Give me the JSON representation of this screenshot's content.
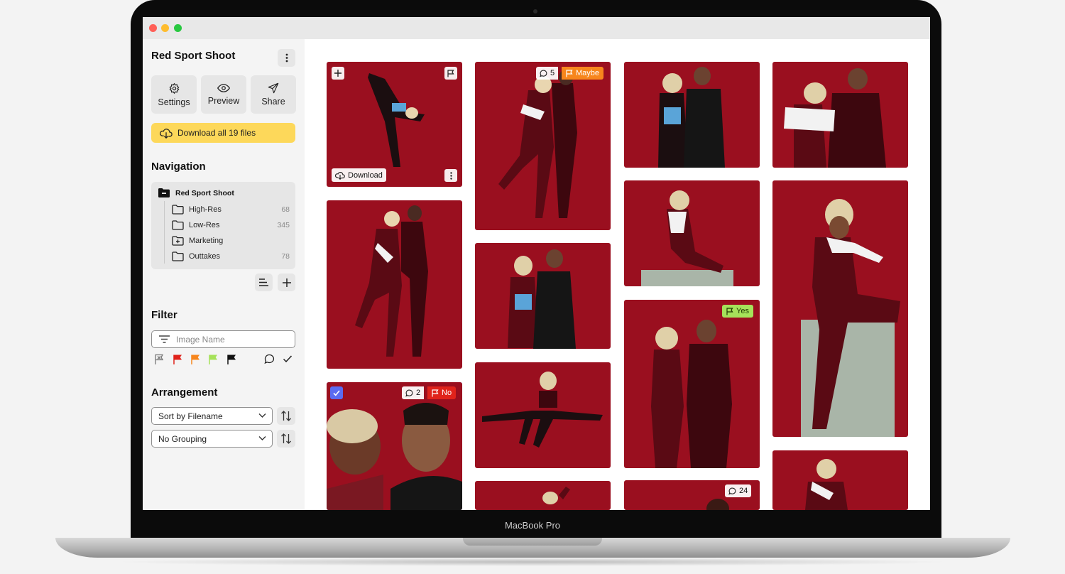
{
  "device": {
    "label": "MacBook Pro"
  },
  "sidebar": {
    "project_title": "Red Sport Shoot",
    "actions": {
      "settings": "Settings",
      "preview": "Preview",
      "share": "Share"
    },
    "download_all": "Download all 19 files",
    "navigation": {
      "title": "Navigation",
      "root": "Red Sport Shoot",
      "folders": [
        {
          "name": "High-Res",
          "count": "68",
          "icon": "folder-icon"
        },
        {
          "name": "Low-Res",
          "count": "345",
          "icon": "folder-icon"
        },
        {
          "name": "Marketing",
          "count": "",
          "icon": "folder-plus-icon"
        },
        {
          "name": "Outtakes",
          "count": "78",
          "icon": "folder-icon"
        }
      ]
    },
    "filter": {
      "title": "Filter",
      "placeholder": "Image Name",
      "flag_colors": [
        "#777777",
        "#e0231b",
        "#f7861d",
        "#a6e25a",
        "#111111"
      ]
    },
    "arrangement": {
      "title": "Arrangement",
      "sort": "Sort by Filename",
      "group": "No Grouping"
    }
  },
  "gallery": {
    "download_label": "Download",
    "comment_counts": {
      "photo_2": "5",
      "photo_9": "2",
      "photo_14": "24"
    },
    "tags": {
      "photo_2": "Maybe",
      "photo_9": "No",
      "photo_11": "Yes"
    }
  },
  "colors": {
    "accent": "#5b6bf0",
    "highlight": "#fdd85a",
    "backdrop": "#9a0f1f"
  }
}
